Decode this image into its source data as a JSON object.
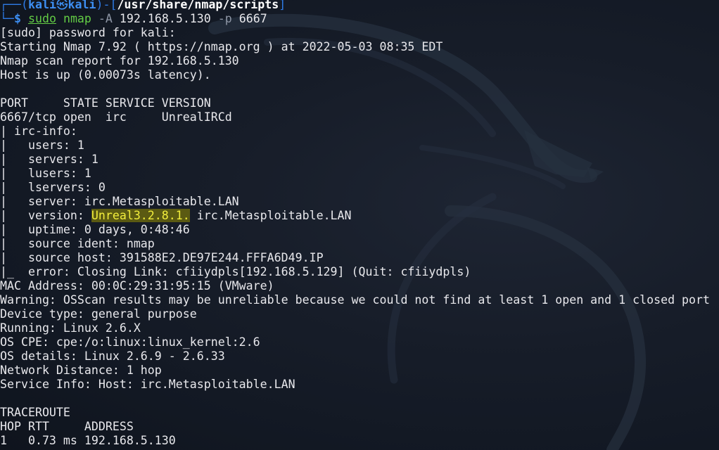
{
  "prompt": {
    "frame_top": "┌──(",
    "user": "kali",
    "skull": "㉿",
    "host": "kali",
    "frame_mid": ")-[",
    "cwd": "/usr/share/nmap/scripts",
    "frame_end": "]",
    "frame_bottom": "└─",
    "dollar": "$"
  },
  "command": {
    "sudo": "sudo",
    "program": "nmap",
    "flag_a": "-A",
    "target": "192.168.5.130",
    "flag_p": "-p",
    "port": "6667"
  },
  "output": {
    "sudo_prompt": "[sudo] password for kali:",
    "starting": "Starting Nmap 7.92 ( https://nmap.org ) at 2022-05-03 08:35 EDT",
    "report": "Nmap scan report for 192.168.5.130",
    "host_up": "Host is up (0.00073s latency).",
    "blank1": "",
    "port_header": "PORT     STATE SERVICE VERSION",
    "port_row": "6667/tcp open  irc     UnrealIRCd",
    "irc_info": "| irc-info:",
    "users": "|   users: 1",
    "servers": "|   servers: 1",
    "lusers": "|   lusers: 1",
    "lservers": "|   lservers: 0",
    "server": "|   server: irc.Metasploitable.LAN",
    "version_prefix": "|   version: ",
    "version_highlight": "Unreal3.2.8.1.",
    "version_suffix": " irc.Metasploitable.LAN",
    "uptime": "|   uptime: 0 days, 0:48:46",
    "source_ident": "|   source ident: nmap",
    "source_host": "|   source host: 391588E2.DE97E244.FFFA6D49.IP",
    "error": "|_  error: Closing Link: cfiiydpls[192.168.5.129] (Quit: cfiiydpls)",
    "mac": "MAC Address: 00:0C:29:31:95:15 (VMware)",
    "warning": "Warning: OSScan results may be unreliable because we could not find at least 1 open and 1 closed port",
    "device_type": "Device type: general purpose",
    "running": "Running: Linux 2.6.X",
    "os_cpe": "OS CPE: cpe:/o:linux:linux_kernel:2.6",
    "os_details": "OS details: Linux 2.6.9 - 2.6.33",
    "network_distance": "Network Distance: 1 hop",
    "service_info": "Service Info: Host: irc.Metasploitable.LAN",
    "blank2": "",
    "traceroute": "TRACEROUTE",
    "trace_header": "HOP RTT     ADDRESS",
    "trace_row": "1   0.73 ms 192.168.5.130"
  },
  "colors": {
    "background": "#171d29",
    "prompt_blue": "#3d8ff3",
    "command_green": "#63cc45",
    "highlight_bg": "#5b5a12",
    "highlight_fg": "#f2ee3c",
    "text": "#e8e8ec"
  },
  "icons": {
    "background": "kali-dragon-watermark"
  }
}
